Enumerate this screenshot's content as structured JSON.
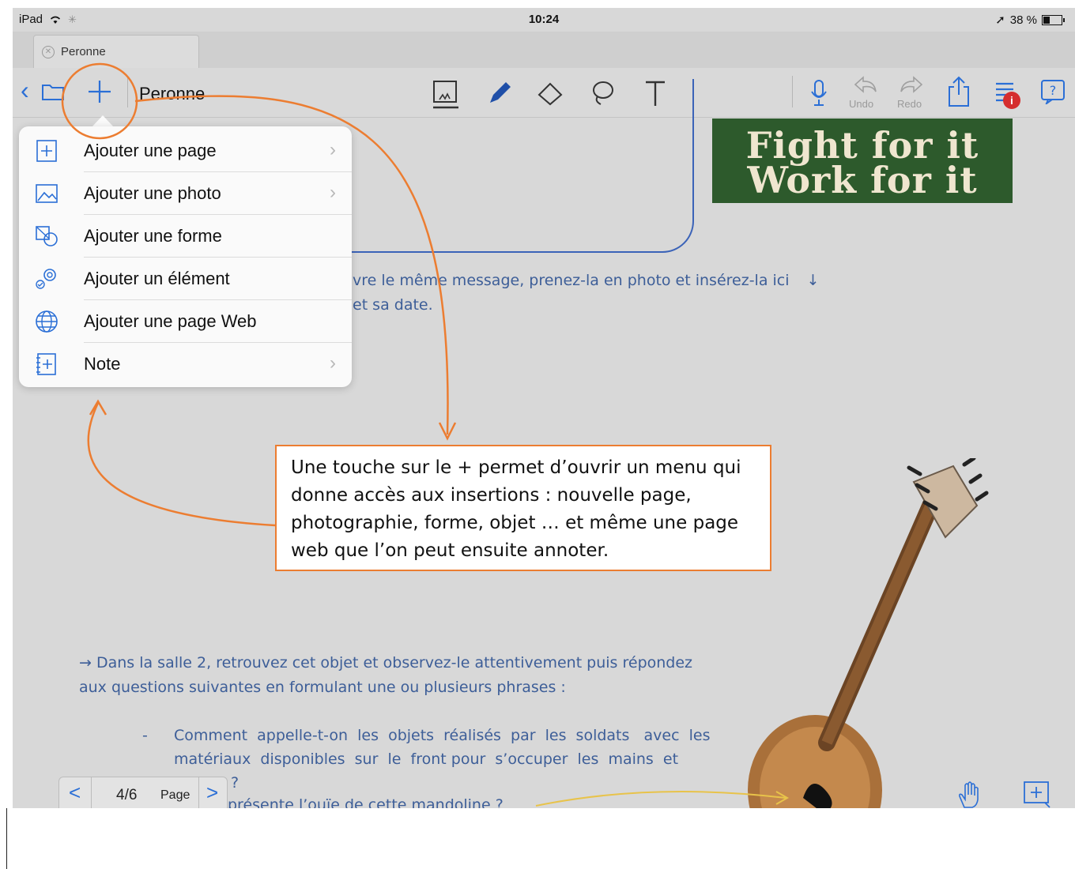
{
  "status_bar": {
    "device": "iPad",
    "time": "10:24",
    "battery": "38 %"
  },
  "tab": {
    "title": "Peronne"
  },
  "toolbar": {
    "title": "Peronne",
    "undo_label": "Undo",
    "redo_label": "Redo",
    "badge": "i"
  },
  "document": {
    "poster_line1": "Fight for it",
    "poster_line2": "Work for it",
    "line1": "vre le même message, prenez-la en photo et insérez-la ici",
    "line1_arrow": "↓",
    "line2": "et sa date.",
    "para1_line1": "→ Dans la salle 2, retrouvez cet objet et observez-le attentivement puis répondez",
    "para1_line2": "aux questions suivantes en formulant une ou plusieurs phrases :",
    "bullet_dash": "-",
    "q1_line1": "Comment  appelle-t-on  les  objets  réalisés  par  les  soldats   avec  les",
    "q1_line2": "matériaux  disponibles  sur  le  front pour  s’occuper  les  mains  et",
    "q1_line3": "?",
    "q2_partial": "présente l’ouïe de cette mandoline ?"
  },
  "menu": {
    "items": [
      {
        "label": "Ajouter une page",
        "icon": "add-page-icon",
        "chevron": "›"
      },
      {
        "label": "Ajouter une photo",
        "icon": "photo-icon",
        "chevron": "›"
      },
      {
        "label": "Ajouter une forme",
        "icon": "shape-icon",
        "chevron": ""
      },
      {
        "label": "Ajouter un élément",
        "icon": "element-icon",
        "chevron": ""
      },
      {
        "label": "Ajouter une page Web",
        "icon": "globe-icon",
        "chevron": ""
      },
      {
        "label": "Note",
        "icon": "note-icon",
        "chevron": "›"
      }
    ]
  },
  "callout": {
    "text": "Une touche sur le + permet d’ouvrir un menu qui donne accès aux insertions : nouvelle page, photographie, forme, objet … et même une page web que l’on peut ensuite annoter."
  },
  "pager": {
    "prev": "<",
    "next": ">",
    "page": "4/6",
    "label": "Page"
  },
  "colors": {
    "accent": "#2b6fd6",
    "callout_border": "#ec7d31",
    "doc_text": "#3d5e98",
    "annotation_arrow": "#e8c34a"
  }
}
